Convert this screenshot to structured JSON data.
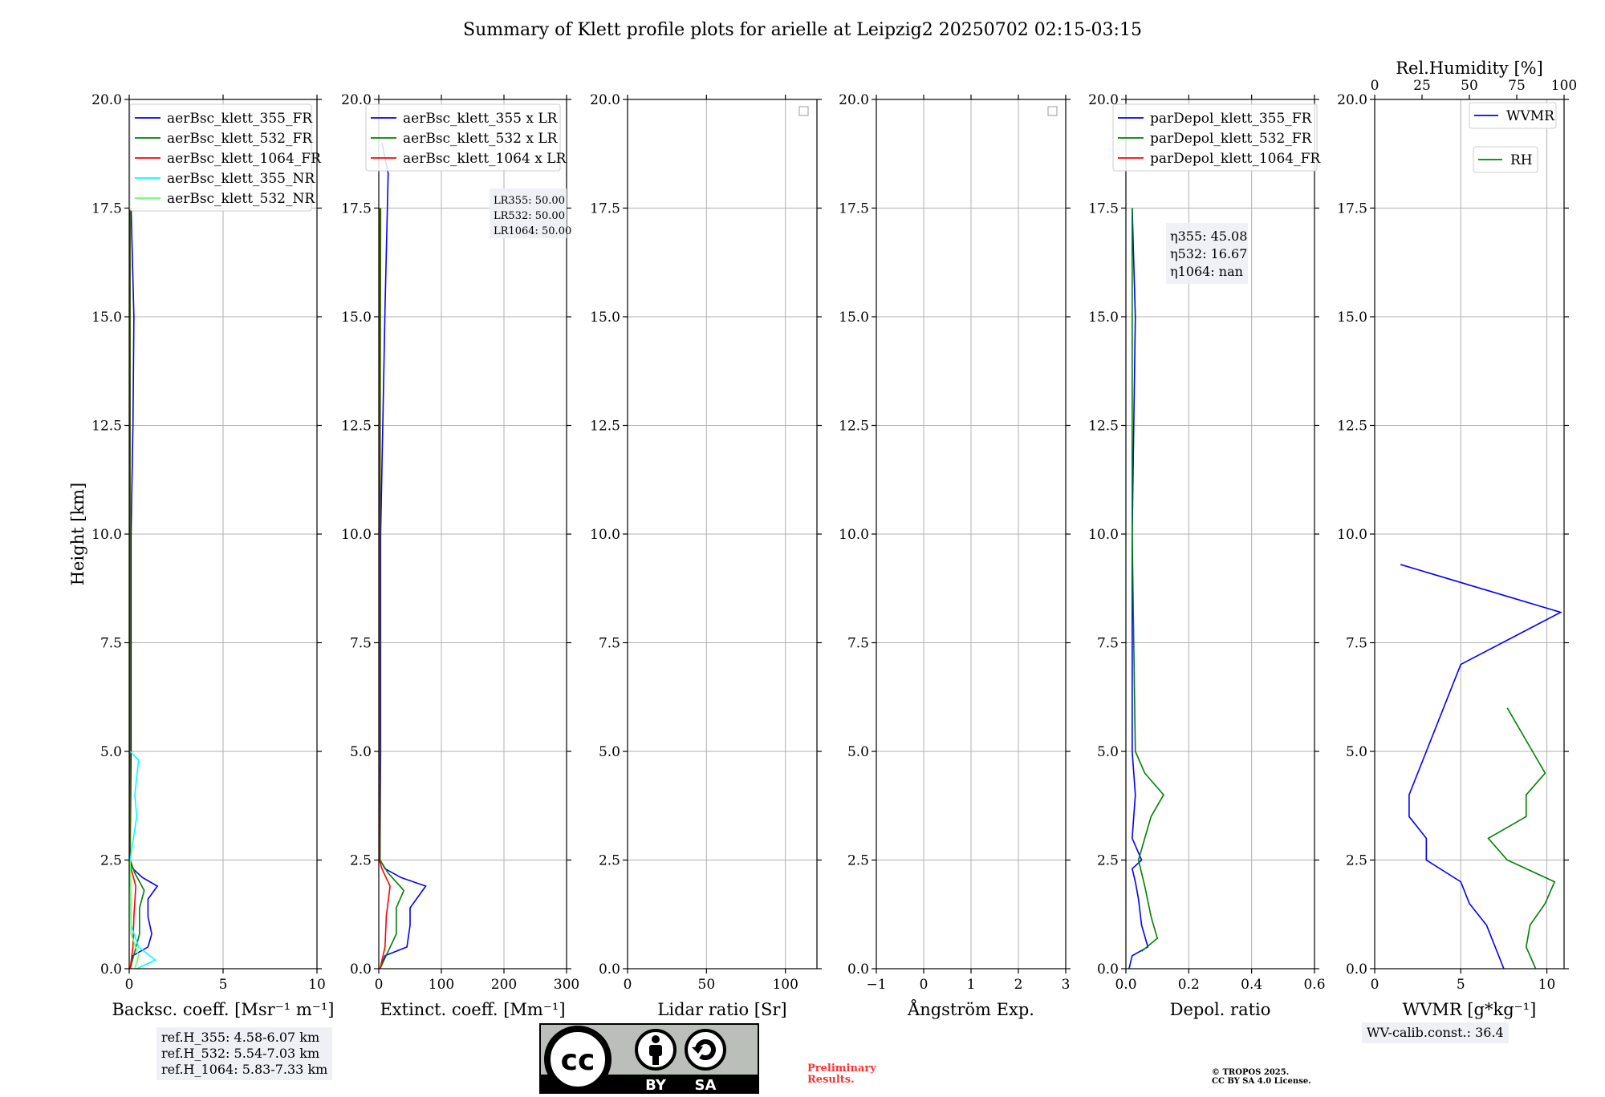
{
  "figure_title": "Summary of Klett profile plots for arielle at Leipzig2 20250702 02:15-03:15",
  "ref_heights": [
    "ref.H_355: 4.58-6.07 km",
    "ref.H_532: 5.54-7.03 km",
    "ref.H_1064: 5.83-7.33 km"
  ],
  "wv_calib": "WV-calib.const.: 36.4",
  "preliminary": [
    "Preliminary",
    "Results."
  ],
  "copyright": [
    "© TROPOS 2025.",
    "CC BY SA 4.0 License."
  ],
  "cc_logo": {
    "text": "cc",
    "by": "BY",
    "sa": "SA"
  },
  "colors": {
    "c355": "#0000ff",
    "c532": "#008000",
    "c1064": "#ff0000",
    "c355nr": "#00ffff",
    "c532nr": "#66ff66",
    "grid": "#b0b0b0"
  },
  "chart_data": [
    {
      "type": "line",
      "ylabel": "Height [km]",
      "xlabel": "Backsc. coeff. [Msr⁻¹ m⁻¹]",
      "xlim": [
        0,
        10
      ],
      "ylim": [
        0,
        20
      ],
      "xticks": [
        "0",
        "5",
        "10"
      ],
      "yticks": [
        "0.0",
        "2.5",
        "5.0",
        "7.5",
        "10.0",
        "12.5",
        "15.0",
        "17.5",
        "20.0"
      ],
      "legend": [
        "aerBsc_klett_355_FR",
        "aerBsc_klett_532_FR",
        "aerBsc_klett_1064_FR",
        "aerBsc_klett_355_NR",
        "aerBsc_klett_532_NR"
      ],
      "series": [
        {
          "name": "aerBsc_klett_355_FR",
          "color": "#0000ff",
          "points": [
            [
              0.05,
              0
            ],
            [
              0.2,
              0.3
            ],
            [
              1.0,
              0.5
            ],
            [
              1.2,
              0.8
            ],
            [
              1.0,
              1.2
            ],
            [
              1.0,
              1.6
            ],
            [
              1.5,
              1.9
            ],
            [
              0.7,
              2.1
            ],
            [
              0.2,
              2.3
            ],
            [
              0.05,
              2.5
            ],
            [
              0.1,
              5
            ],
            [
              0.1,
              7.5
            ],
            [
              0.1,
              10
            ],
            [
              0.2,
              12.5
            ],
            [
              0.25,
              15
            ],
            [
              0.1,
              17.5
            ]
          ]
        },
        {
          "name": "aerBsc_klett_532_FR",
          "color": "#008000",
          "points": [
            [
              0.05,
              0
            ],
            [
              0.3,
              0.4
            ],
            [
              0.55,
              0.8
            ],
            [
              0.55,
              1.4
            ],
            [
              0.8,
              1.8
            ],
            [
              0.3,
              2.2
            ],
            [
              0.05,
              2.5
            ],
            [
              0.05,
              5
            ],
            [
              0.05,
              10
            ],
            [
              0.05,
              17.5
            ]
          ]
        },
        {
          "name": "aerBsc_klett_1064_FR",
          "color": "#ff0000",
          "points": [
            [
              0.05,
              0
            ],
            [
              0.2,
              0.5
            ],
            [
              0.25,
              1.2
            ],
            [
              0.35,
              1.9
            ],
            [
              0.1,
              2.3
            ],
            [
              0.02,
              2.5
            ],
            [
              0.02,
              10
            ],
            [
              0.02,
              17.5
            ]
          ]
        },
        {
          "name": "aerBsc_klett_355_NR",
          "color": "#00ffff",
          "points": [
            [
              0.4,
              0
            ],
            [
              1.4,
              0.2
            ],
            [
              0.5,
              0.5
            ],
            [
              0.1,
              1
            ],
            [
              0.05,
              2.5
            ],
            [
              0.4,
              3.5
            ],
            [
              0.3,
              4
            ],
            [
              0.5,
              4.8
            ],
            [
              0.05,
              5
            ]
          ]
        },
        {
          "name": "aerBsc_klett_532_NR",
          "color": "#66ff66",
          "points": [
            [
              0.3,
              0
            ],
            [
              0.5,
              0.3
            ],
            [
              0.1,
              0.8
            ],
            [
              0.05,
              2.5
            ]
          ]
        }
      ],
      "annotation": ""
    },
    {
      "type": "line",
      "xlabel": "Extinct. coeff. [Mm⁻¹]",
      "xlim": [
        0,
        300
      ],
      "ylim": [
        0,
        20
      ],
      "xticks": [
        "0",
        "100",
        "200",
        "300"
      ],
      "yticks": [
        "0.0",
        "2.5",
        "5.0",
        "7.5",
        "10.0",
        "12.5",
        "15.0",
        "17.5",
        "20.0"
      ],
      "legend": [
        "aerBsc_klett_355 x LR",
        "aerBsc_klett_532 x LR",
        "aerBsc_klett_1064 x LR"
      ],
      "series": [
        {
          "name": "aerBsc_klett_355 x LR",
          "color": "#0000ff",
          "points": [
            [
              2,
              0
            ],
            [
              10,
              0.3
            ],
            [
              45,
              0.5
            ],
            [
              50,
              1
            ],
            [
              50,
              1.4
            ],
            [
              75,
              1.9
            ],
            [
              35,
              2.1
            ],
            [
              10,
              2.3
            ],
            [
              2,
              2.5
            ],
            [
              3,
              5
            ],
            [
              3,
              10
            ],
            [
              8,
              13.7
            ],
            [
              10,
              15.2
            ],
            [
              15,
              18.3
            ],
            [
              5,
              19
            ]
          ]
        },
        {
          "name": "aerBsc_klett_532 x LR",
          "color": "#008000",
          "points": [
            [
              2,
              0
            ],
            [
              15,
              0.4
            ],
            [
              28,
              0.8
            ],
            [
              28,
              1.4
            ],
            [
              40,
              1.8
            ],
            [
              15,
              2.2
            ],
            [
              2,
              2.5
            ],
            [
              2,
              10
            ],
            [
              3,
              17.5
            ]
          ]
        },
        {
          "name": "aerBsc_klett_1064 x LR",
          "color": "#ff0000",
          "points": [
            [
              2,
              0
            ],
            [
              10,
              0.5
            ],
            [
              12,
              1.2
            ],
            [
              18,
              1.9
            ],
            [
              5,
              2.3
            ],
            [
              1,
              2.5
            ],
            [
              1,
              10
            ],
            [
              1,
              17.5
            ]
          ]
        }
      ],
      "annotation": "LR355: 50.00 / LR532: 50.00 / LR1064: 50.00"
    },
    {
      "type": "line",
      "xlabel": "Lidar ratio [Sr]",
      "xlim": [
        0,
        120
      ],
      "ylim": [
        0,
        20
      ],
      "xticks": [
        "0",
        "50",
        "100"
      ],
      "yticks": [
        "0.0",
        "2.5",
        "5.0",
        "7.5",
        "10.0",
        "12.5",
        "15.0",
        "17.5",
        "20.0"
      ],
      "series": []
    },
    {
      "type": "line",
      "xlabel": "Ångström Exp.",
      "xlim": [
        -1,
        3
      ],
      "ylim": [
        0,
        20
      ],
      "xticks": [
        "−1",
        "0",
        "1",
        "2",
        "3"
      ],
      "yticks": [
        "0.0",
        "2.5",
        "5.0",
        "7.5",
        "10.0",
        "12.5",
        "15.0",
        "17.5",
        "20.0"
      ],
      "series": []
    },
    {
      "type": "line",
      "xlabel": "Depol. ratio",
      "xlim": [
        0,
        0.6
      ],
      "ylim": [
        0,
        20
      ],
      "xticks": [
        "0.0",
        "0.2",
        "0.4",
        "0.6"
      ],
      "yticks": [
        "0.0",
        "2.5",
        "5.0",
        "7.5",
        "10.0",
        "12.5",
        "15.0",
        "17.5",
        "20.0"
      ],
      "legend": [
        "parDepol_klett_355_FR",
        "parDepol_klett_532_FR",
        "parDepol_klett_1064_FR"
      ],
      "series": [
        {
          "name": "parDepol_klett_355_FR",
          "color": "#0000ff",
          "points": [
            [
              0.01,
              0
            ],
            [
              0.02,
              0.3
            ],
            [
              0.07,
              0.5
            ],
            [
              0.05,
              1
            ],
            [
              0.04,
              1.6
            ],
            [
              0.03,
              2
            ],
            [
              0.02,
              2.3
            ],
            [
              0.05,
              2.5
            ],
            [
              0.02,
              3
            ],
            [
              0.03,
              4
            ],
            [
              0.02,
              5
            ],
            [
              0.02,
              10
            ],
            [
              0.03,
              15
            ],
            [
              0.02,
              17.5
            ]
          ]
        },
        {
          "name": "parDepol_klett_532_FR",
          "color": "#008000",
          "points": [
            [
              0.05,
              0.4
            ],
            [
              0.1,
              0.7
            ],
            [
              0.08,
              1.2
            ],
            [
              0.06,
              1.9
            ],
            [
              0.04,
              2.5
            ],
            [
              0.06,
              3
            ],
            [
              0.08,
              3.5
            ],
            [
              0.12,
              4
            ],
            [
              0.06,
              4.5
            ],
            [
              0.03,
              5
            ],
            [
              0.02,
              10
            ],
            [
              0.02,
              17.5
            ]
          ]
        }
      ],
      "annotation": "η355: 45.08 / η532: 16.67 / η1064: nan"
    },
    {
      "type": "line",
      "xlabel": "WVMR [g*kg⁻¹]",
      "top_xlabel": "Rel.Humidity [%]",
      "xlim": [
        0,
        11
      ],
      "ylim": [
        0,
        20
      ],
      "top_xlim": [
        0,
        100
      ],
      "xticks": [
        "0",
        "5",
        "10"
      ],
      "top_xticks": [
        "0",
        "25",
        "50",
        "75",
        "100"
      ],
      "yticks": [
        "0.0",
        "2.5",
        "5.0",
        "7.5",
        "10.0",
        "12.5",
        "15.0",
        "17.5",
        "20.0"
      ],
      "legend": [
        "WVMR",
        "RH"
      ],
      "series": [
        {
          "name": "WVMR",
          "color": "#0000ff",
          "points": [
            [
              7.5,
              0
            ],
            [
              7,
              0.5
            ],
            [
              6.5,
              1
            ],
            [
              5.5,
              1.5
            ],
            [
              5,
              2
            ],
            [
              3,
              2.5
            ],
            [
              3,
              3
            ],
            [
              2,
              3.5
            ],
            [
              2,
              4
            ],
            [
              3,
              5
            ],
            [
              4,
              6
            ],
            [
              5,
              7
            ],
            [
              10.8,
              8.2
            ],
            [
              1.5,
              9.3
            ]
          ]
        },
        {
          "name": "RH",
          "color": "#008000",
          "points": [
            [
              85,
              0
            ],
            [
              80,
              0.5
            ],
            [
              82,
              1
            ],
            [
              90,
              1.5
            ],
            [
              95,
              2
            ],
            [
              70,
              2.5
            ],
            [
              60,
              3
            ],
            [
              80,
              3.5
            ],
            [
              80,
              4
            ],
            [
              90,
              4.5
            ],
            [
              70,
              6
            ]
          ]
        }
      ]
    }
  ]
}
